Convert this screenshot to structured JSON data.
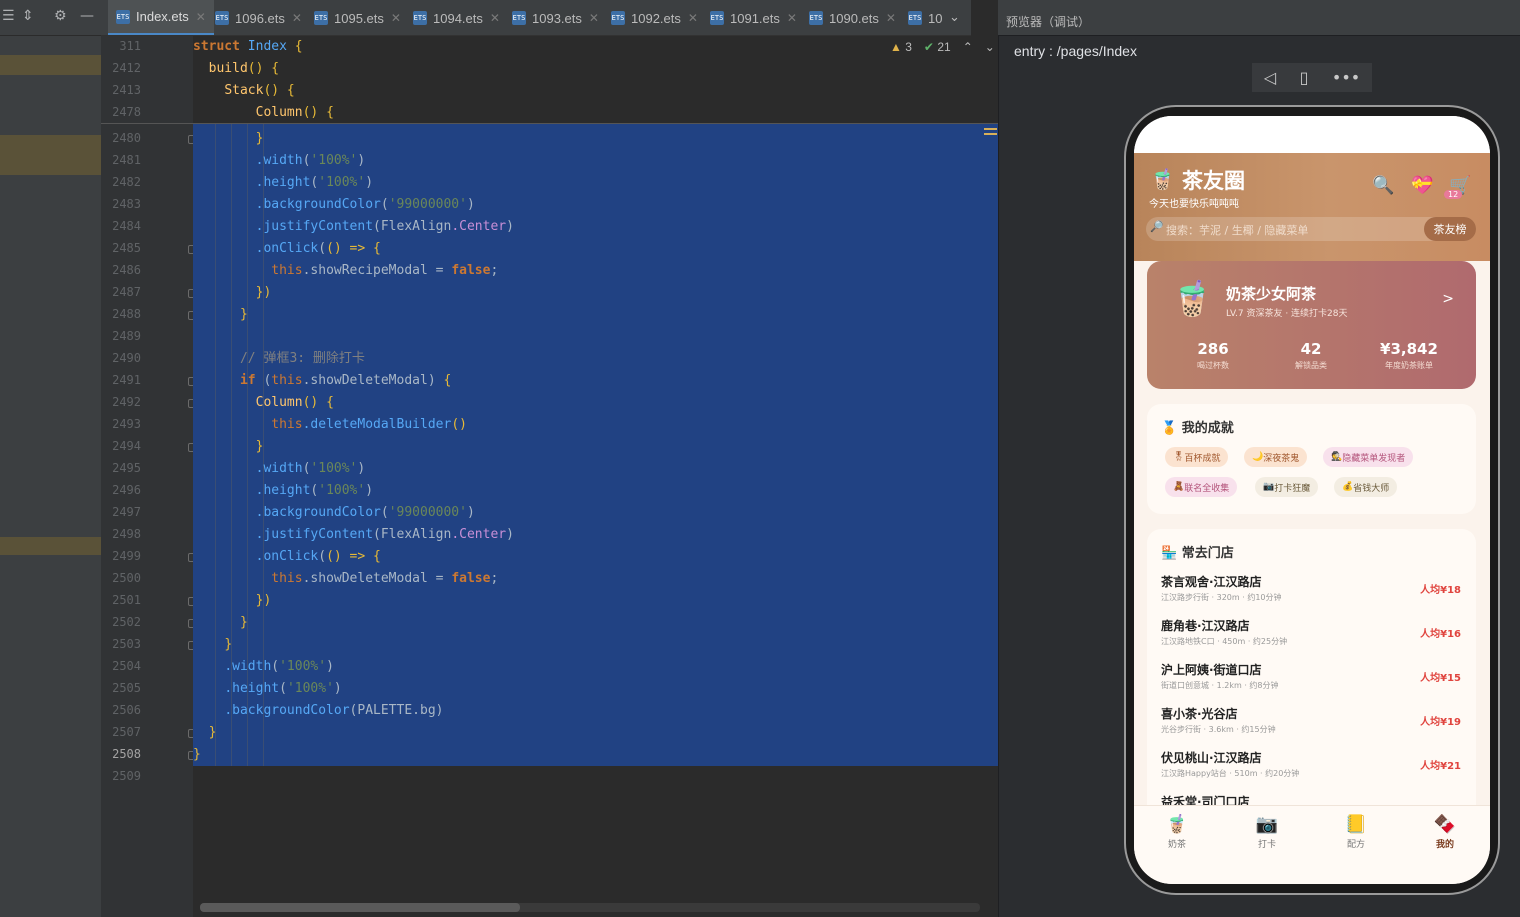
{
  "editor": {
    "tabs": [
      {
        "label": "Index.ets",
        "active": true
      },
      {
        "label": "1096.ets"
      },
      {
        "label": "1095.ets"
      },
      {
        "label": "1094.ets"
      },
      {
        "label": "1093.ets"
      },
      {
        "label": "1092.ets"
      },
      {
        "label": "1091.ets"
      },
      {
        "label": "1090.ets"
      },
      {
        "label": "10"
      }
    ],
    "warnings": "3",
    "checks": "21",
    "line_numbers": [
      "311",
      "2412",
      "2413",
      "2478",
      "2480",
      "2481",
      "2482",
      "2483",
      "2484",
      "2485",
      "2486",
      "2487",
      "2488",
      "2489",
      "2490",
      "2491",
      "2492",
      "2493",
      "2494",
      "2495",
      "2496",
      "2497",
      "2498",
      "2499",
      "2500",
      "2501",
      "2502",
      "2503",
      "2504",
      "2505",
      "2506",
      "2507",
      "2508",
      "2509"
    ],
    "code": {
      "struct_kw": "struct",
      "struct_name": "Index",
      "build": "build",
      "stack": "Stack",
      "column": "Column",
      "width": ".width",
      "height": ".height",
      "bg": ".backgroundColor",
      "jc": ".justifyContent",
      "onclick": ".onClick",
      "pct": "'100%'",
      "color": "'99000000'",
      "flex": "FlexAlign",
      "center": ".Center",
      "this": "this",
      "show_recipe": ".showRecipeModal = ",
      "show_delete_cond": ".showDeleteModal",
      "show_delete_set": ".showDeleteModal = ",
      "false_kw": "false",
      "if_kw": "if",
      "comment": "// 弹框3: 删除打卡",
      "builder": ".deleteModalBuilder",
      "palette": "PALETTE.bg",
      "arrow": "() =>"
    }
  },
  "preview": {
    "title": "预览器（调试）",
    "route": "entry : /pages/Index",
    "app": {
      "title": "茶友圈",
      "subtitle": "今天也要快乐吨吨吨",
      "search_placeholder": "搜索：芋泥 / 生椰 / 隐藏菜单",
      "rank_button": "茶友榜",
      "cart_badge": "12",
      "profile": {
        "name": "奶茶少女阿茶",
        "level": "LV.7 资深茶友 · 连续打卡28天",
        "arrow": ">",
        "stats": [
          {
            "value": "286",
            "label": "喝过杯数"
          },
          {
            "value": "42",
            "label": "解锁品类"
          },
          {
            "value": "¥3,842",
            "label": "年度奶茶账单"
          }
        ]
      },
      "achievements": {
        "title": "我的成就",
        "chips": [
          "百杯成就",
          "深夜茶鬼",
          "隐藏菜单发现者",
          "联名全收集",
          "打卡狂魔",
          "省钱大师"
        ]
      },
      "stores": {
        "title": "常去门店",
        "items": [
          {
            "name": "茶言观舍·江汉路店",
            "detail": "江汉路步行街 · 320m · 约10分钟",
            "price": "人均¥18"
          },
          {
            "name": "鹿角巷·江汉路店",
            "detail": "江汉路地铁C口 · 450m · 约25分钟",
            "price": "人均¥16"
          },
          {
            "name": "沪上阿姨·街道口店",
            "detail": "街道口创意城 · 1.2km · 约8分钟",
            "price": "人均¥15"
          },
          {
            "name": "喜小茶·光谷店",
            "detail": "光谷步行街 · 3.6km · 约15分钟",
            "price": "人均¥19"
          },
          {
            "name": "伏见桃山·江汉路店",
            "detail": "江汉路Happy站台 · 510m · 约20分钟",
            "price": "人均¥21"
          },
          {
            "name": "益禾堂·司门口店",
            "detail": "",
            "price": ""
          }
        ]
      },
      "tabbar": [
        {
          "label": "奶茶"
        },
        {
          "label": "打卡"
        },
        {
          "label": "配方"
        },
        {
          "label": "我的"
        }
      ]
    }
  }
}
